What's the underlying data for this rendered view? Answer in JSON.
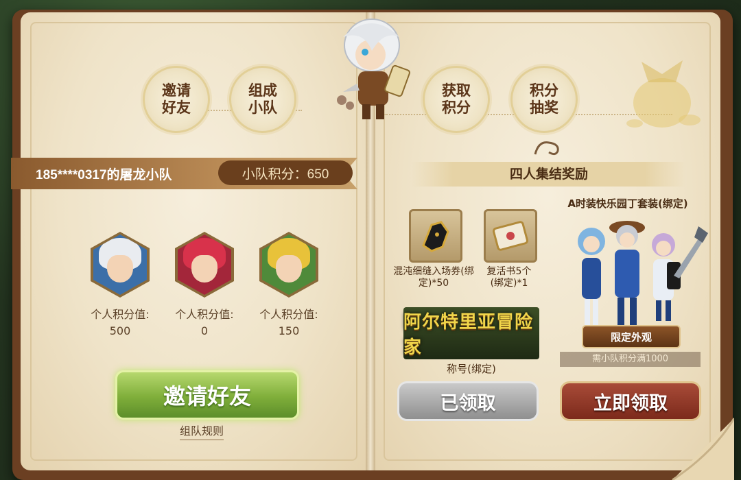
{
  "steps": {
    "invite": "邀请好友",
    "team": "组成小队",
    "earn": "获取积分",
    "draw": "积分抽奖"
  },
  "team": {
    "name": "185****0317的屠龙小队",
    "score_label": "小队积分：650"
  },
  "members": [
    {
      "label": "个人积分值:",
      "score": "500",
      "hair_color": "#e9ecf0"
    },
    {
      "label": "个人积分值:",
      "score": "0",
      "hair_color": "#d8324b"
    },
    {
      "label": "个人积分值:",
      "score": "150",
      "hair_color": "#e8c23a"
    }
  ],
  "left_actions": {
    "invite_button": "邀请好友",
    "rules_link": "组队规则"
  },
  "reward": {
    "title": "四人集结奖励",
    "items": [
      {
        "label": "混沌细缝入场券(绑定)*50"
      },
      {
        "label": "复活书5个(绑定)*1"
      }
    ],
    "title_item_art": "阿尔特里亚冒险家",
    "title_item_label": "称号(绑定)",
    "costume_title": "A时装快乐园丁套装(绑定)",
    "limited_badge": "限定外观",
    "requirement": "需小队积分满1000",
    "claimed_button": "已领取",
    "claim_button": "立即领取"
  },
  "colors": {
    "accent_green": "#7fae3a",
    "accent_brown": "#6a3f1d",
    "claim_red": "#7c2a1b"
  }
}
